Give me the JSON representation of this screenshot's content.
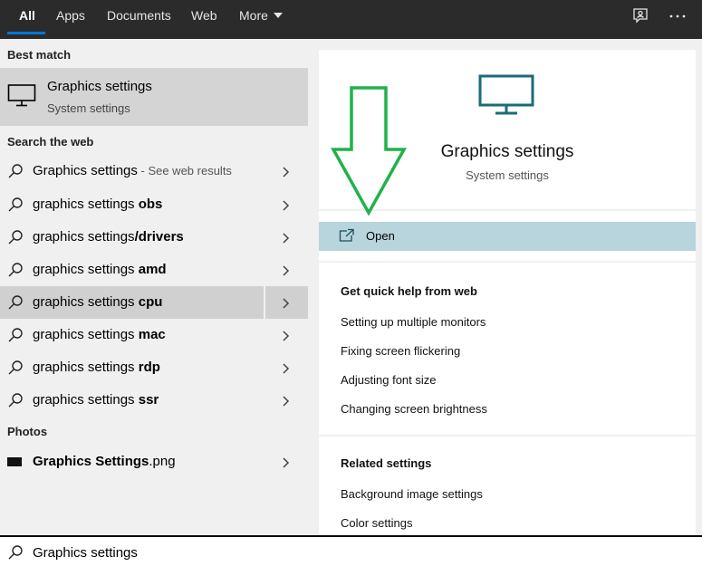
{
  "tabs": [
    {
      "label": "All",
      "active": true
    },
    {
      "label": "Apps"
    },
    {
      "label": "Documents"
    },
    {
      "label": "Web"
    },
    {
      "label": "More"
    }
  ],
  "topbar_icons": [
    "feedback-icon",
    "ellipsis-icon"
  ],
  "best_match": {
    "header": "Best match",
    "title": "Graphics settings",
    "subtitle": "System settings",
    "icon": "monitor-icon"
  },
  "web": {
    "header": "Search the web",
    "items": [
      {
        "prefix": "Graphics settings",
        "bold": "",
        "hint": " - See web results"
      },
      {
        "prefix": "graphics settings ",
        "bold": "obs",
        "hint": ""
      },
      {
        "prefix": "graphics settings",
        "bold": "/drivers",
        "hint": ""
      },
      {
        "prefix": "graphics settings ",
        "bold": "amd",
        "hint": ""
      },
      {
        "prefix": "graphics settings ",
        "bold": "cpu",
        "hint": "",
        "selected": true
      },
      {
        "prefix": "graphics settings ",
        "bold": "mac",
        "hint": ""
      },
      {
        "prefix": "graphics settings ",
        "bold": "rdp",
        "hint": ""
      },
      {
        "prefix": "graphics settings ",
        "bold": "ssr",
        "hint": ""
      }
    ]
  },
  "photos": {
    "header": "Photos",
    "item": {
      "bold": "Graphics Settings",
      "suffix": ".png"
    }
  },
  "preview": {
    "title": "Graphics settings",
    "subtitle": "System settings",
    "open_label": "Open",
    "help_header": "Get quick help from web",
    "help_links": [
      "Setting up multiple monitors",
      "Fixing screen flickering",
      "Adjusting font size",
      "Changing screen brightness"
    ],
    "related_header": "Related settings",
    "related_links": [
      "Background image settings",
      "Color settings"
    ]
  },
  "search_query": "Graphics settings",
  "colors": {
    "accent": "#0078d7",
    "monitor_icon": "#1a6b7a",
    "open_bg": "#b8d4dc",
    "arrow": "#22b14c"
  }
}
